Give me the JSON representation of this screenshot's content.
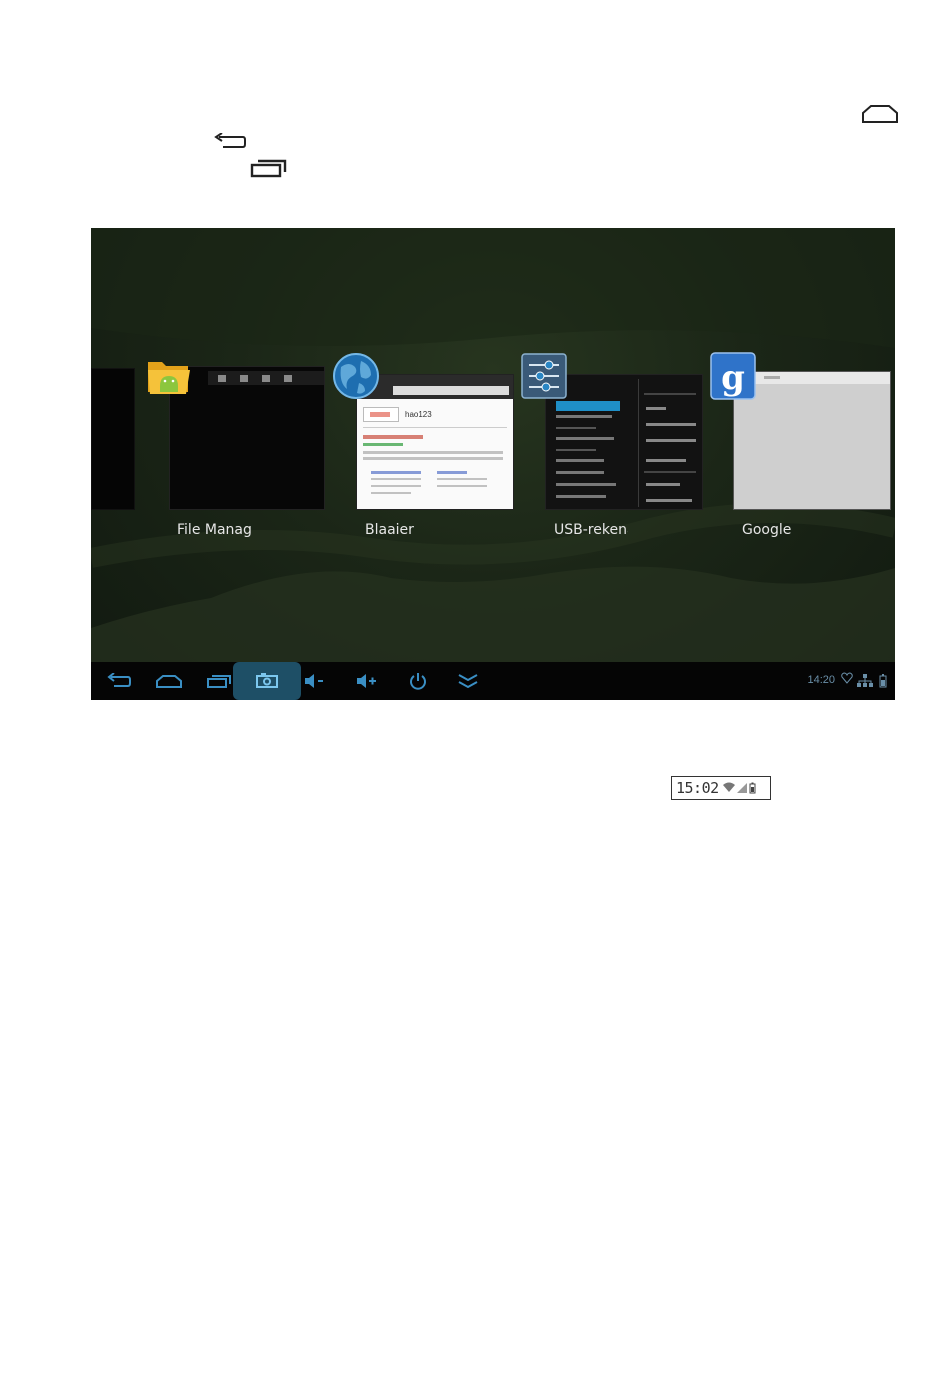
{
  "recent_apps": [
    {
      "label": "File Manage",
      "icon": "folder-android-icon"
    },
    {
      "label": "Blaaier",
      "icon": "globe-icon"
    },
    {
      "label": "USB-rekena",
      "icon": "settings-sliders-icon"
    },
    {
      "label": "Google",
      "icon": "google-g-icon"
    }
  ],
  "browser_thumb": {
    "search_text": "hao123"
  },
  "nav_bar": {
    "time": "14:20",
    "buttons": [
      "back-icon",
      "home-icon",
      "recents-icon",
      "screenshot-icon",
      "volume-down-icon",
      "volume-up-icon",
      "power-icon",
      "expand-icon"
    ]
  },
  "status_sample": {
    "time": "15:02"
  },
  "colors": {
    "nav_active": "#1e4f66",
    "screen_bg": "#1b2617",
    "settings_highlight": "#1f8fc7"
  }
}
